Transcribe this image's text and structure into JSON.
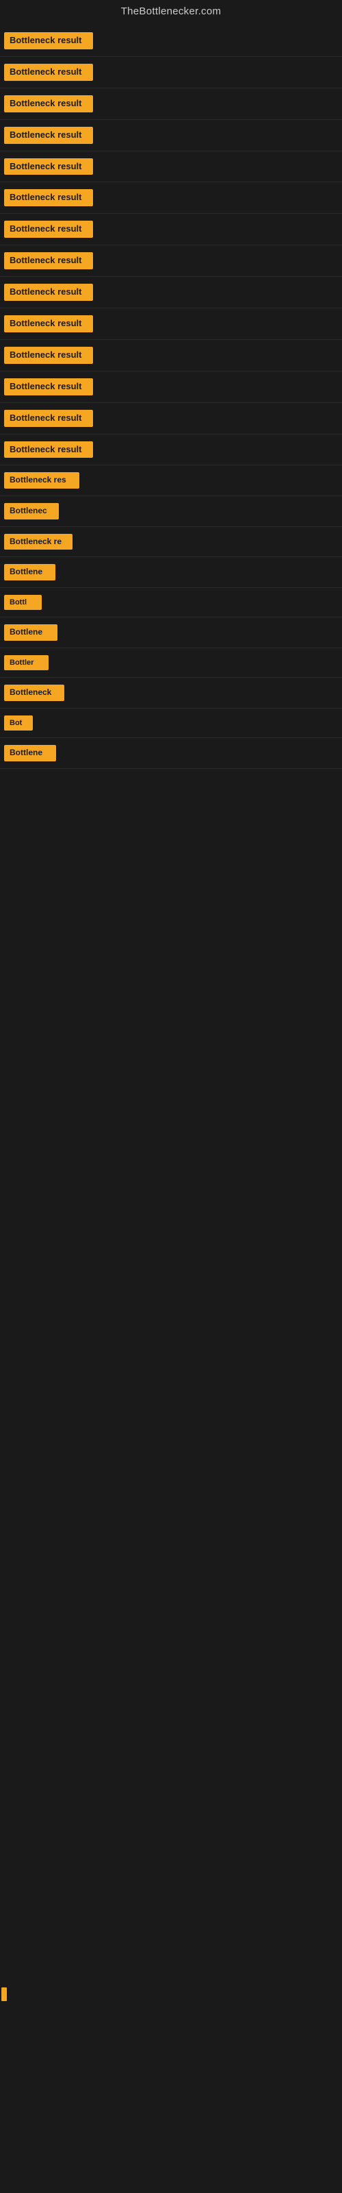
{
  "header": {
    "title": "TheBottlenecker.com"
  },
  "sections": [
    {
      "id": 1,
      "label": "Bottleneck result",
      "class": "section-1"
    },
    {
      "id": 2,
      "label": "Bottleneck result",
      "class": "section-2"
    },
    {
      "id": 3,
      "label": "Bottleneck result",
      "class": "section-3"
    },
    {
      "id": 4,
      "label": "Bottleneck result",
      "class": "section-4"
    },
    {
      "id": 5,
      "label": "Bottleneck result",
      "class": "section-5"
    },
    {
      "id": 6,
      "label": "Bottleneck result",
      "class": "section-6"
    },
    {
      "id": 7,
      "label": "Bottleneck result",
      "class": "section-7"
    },
    {
      "id": 8,
      "label": "Bottleneck result",
      "class": "section-8"
    },
    {
      "id": 9,
      "label": "Bottleneck result",
      "class": "section-9"
    },
    {
      "id": 10,
      "label": "Bottleneck result",
      "class": "section-10"
    },
    {
      "id": 11,
      "label": "Bottleneck result",
      "class": "section-11"
    },
    {
      "id": 12,
      "label": "Bottleneck result",
      "class": "section-12"
    },
    {
      "id": 13,
      "label": "Bottleneck result",
      "class": "section-13"
    },
    {
      "id": 14,
      "label": "Bottleneck result",
      "class": "section-14"
    },
    {
      "id": 15,
      "label": "Bottleneck res",
      "class": "section-15"
    },
    {
      "id": 16,
      "label": "Bottlenec",
      "class": "section-16"
    },
    {
      "id": 17,
      "label": "Bottleneck re",
      "class": "section-17"
    },
    {
      "id": 18,
      "label": "Bottlene",
      "class": "section-18"
    },
    {
      "id": 19,
      "label": "Bottl",
      "class": "section-19"
    },
    {
      "id": 20,
      "label": "Bottlene",
      "class": "section-20"
    },
    {
      "id": 21,
      "label": "Bottler",
      "class": "section-21"
    },
    {
      "id": 22,
      "label": "Bottleneck",
      "class": "section-22"
    },
    {
      "id": 23,
      "label": "Bot",
      "class": "section-23"
    },
    {
      "id": 24,
      "label": "Bottlene",
      "class": "section-24"
    }
  ],
  "colors": {
    "badge_bg": "#f5a623",
    "body_bg": "#1a1a1a",
    "header_color": "#cccccc"
  }
}
